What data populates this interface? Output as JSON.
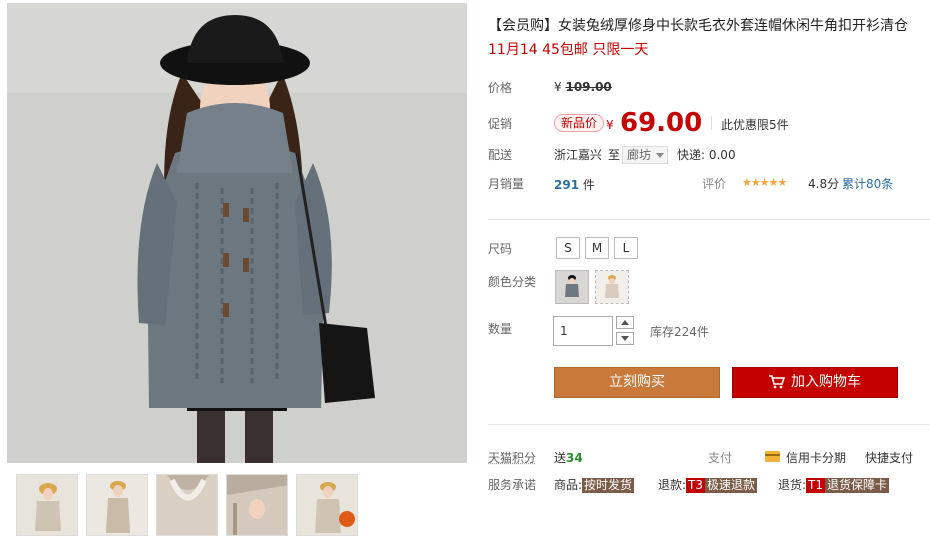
{
  "product": {
    "title": "【会员购】女装兔绒厚修身中长款毛衣外套连帽休闲牛角扣开衫清仓",
    "promo": "11月14 45包邮 只限一天"
  },
  "price": {
    "label": "价格",
    "currency": "¥",
    "original": "109.00",
    "promo_label": "促销",
    "badge": "新品价",
    "current": "69.00",
    "limit": "此优惠限5件"
  },
  "delivery": {
    "label": "配送",
    "from": "浙江嘉兴",
    "to_word": "至",
    "city": "廊坊",
    "express": "快递: 0.00"
  },
  "sales": {
    "label": "月销量",
    "count": "291",
    "unit": "件",
    "rating_label": "评价",
    "stars": "★★★★★",
    "score": "4.8分",
    "reviews": "累计80条"
  },
  "options": {
    "size_label": "尺码",
    "sizes": [
      "S",
      "M",
      "L"
    ],
    "color_label": "颜色分类",
    "qty_label": "数量",
    "qty_value": "1",
    "stock": "库存224件"
  },
  "actions": {
    "buy": "立刻购买",
    "cart": "加入购物车"
  },
  "extras": {
    "points_label": "天猫积分",
    "points_prefix": "送",
    "points_value": "34",
    "pay_label": "支付",
    "card_pay": "信用卡分期",
    "quick_pay": "快捷支付",
    "service_label": "服务承诺",
    "goods_label": "商品:",
    "goods_tag": "按时发货",
    "refund_label": "退款:",
    "refund_code": "T3",
    "refund_tag": "极速退款",
    "return_label": "退货:",
    "return_code": "T1",
    "return_tag": "退货保障卡"
  },
  "colors": {
    "accent_red": "#c40000",
    "buy_orange": "#c97a3a",
    "link_blue": "#2d6fa4",
    "star_gold": "#f3a43b"
  }
}
